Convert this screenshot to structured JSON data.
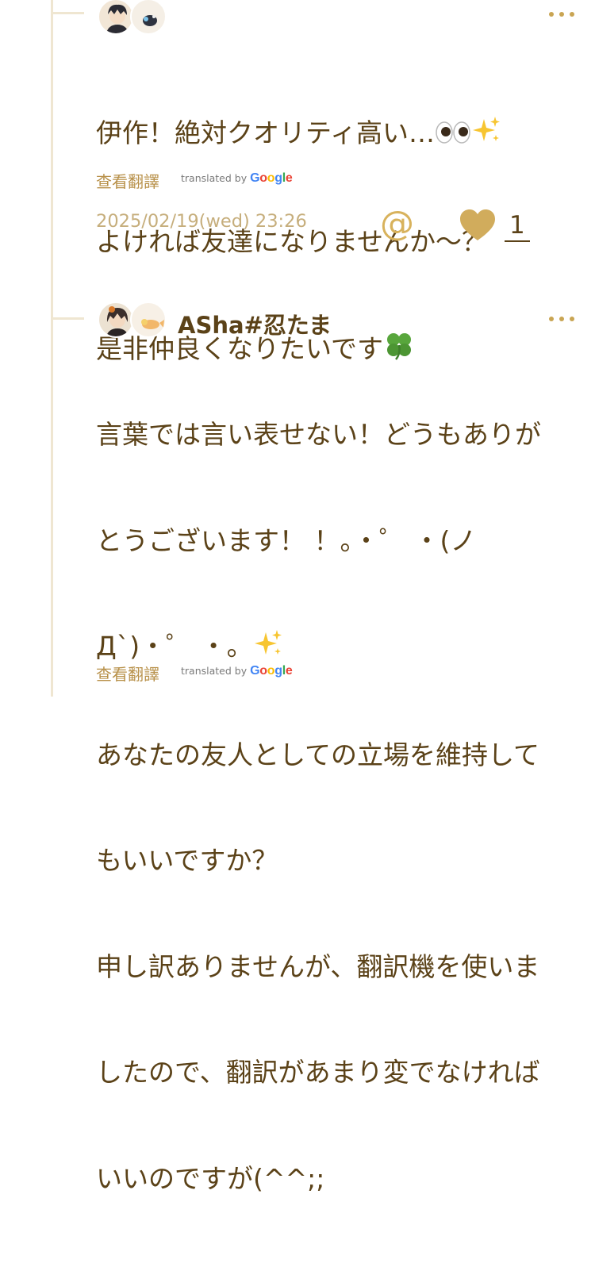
{
  "comments": [
    {
      "username": "",
      "body_lines": [
        "伊作！絶対クオリティ高い…",
        "よければ友達になりませんか～？",
        "是非仲良くなりたいです"
      ],
      "translate_label": "查看翻譯",
      "translated_by": "translated by",
      "google": [
        "G",
        "o",
        "o",
        "g",
        "l",
        "e"
      ],
      "timestamp": "2025/02/19(wed) 23:26",
      "mention_icon": "@",
      "like_count": "1"
    },
    {
      "username": "ASha#忍たま",
      "body_lines": [
        "言葉では言い表せない！どうもありが",
        "とうございます！ ！。・゜ ・(ノ",
        "Д`)・゜ ・。",
        "あなたの友人としての立場を維持して",
        "もいいですか？",
        "申し訳ありませんが、翻訳機を使いま",
        "したので、翻訳があまり変でなければ",
        "いいのですが(^^;;"
      ],
      "translate_label": "查看翻譯",
      "translated_by": "translated by",
      "google": [
        "G",
        "o",
        "o",
        "g",
        "l",
        "e"
      ]
    }
  ],
  "icons": {
    "more": "more-options-icon",
    "mention": "at-mention-icon",
    "like": "heart-icon",
    "eyes": "eyes-emoji-icon",
    "sparkles": "sparkles-emoji-icon",
    "clover": "four-leaf-clover-emoji-icon"
  },
  "colors": {
    "text": "#5b4218",
    "accent": "#d8b25c",
    "heart": "#d1ac5c",
    "thread_line": "#efe6d1",
    "timestamp": "#c6ae7c"
  }
}
